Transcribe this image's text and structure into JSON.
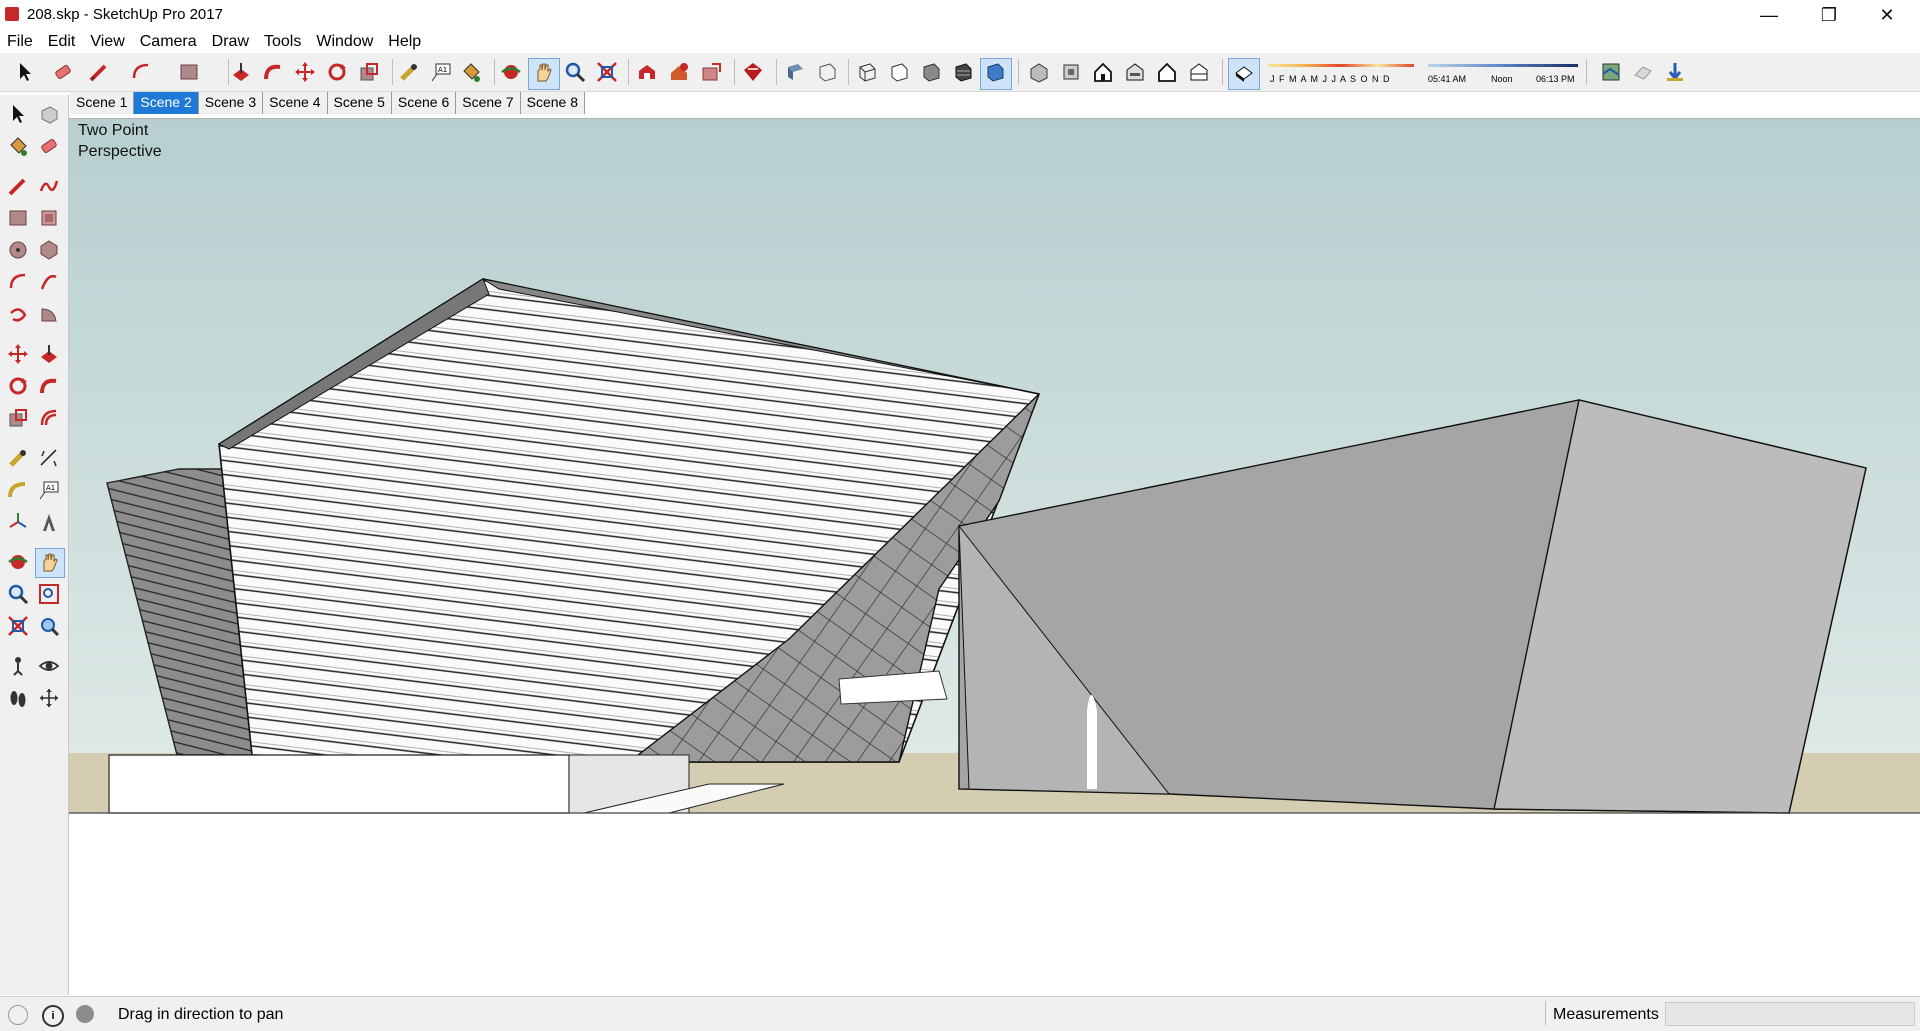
{
  "window": {
    "title": "208.skp - SketchUp Pro 2017",
    "minimize": "—",
    "restore": "❐",
    "close": "✕"
  },
  "menu": [
    "File",
    "Edit",
    "View",
    "Camera",
    "Draw",
    "Tools",
    "Window",
    "Help"
  ],
  "shadow_settings": {
    "months": "J F M A M J J A S O N D",
    "time_start": "05:41 AM",
    "time_mid": "Noon",
    "time_end": "06:13 PM"
  },
  "scenes": [
    "Scene 1",
    "Scene 2",
    "Scene 3",
    "Scene 4",
    "Scene 5",
    "Scene 6",
    "Scene 7",
    "Scene 8"
  ],
  "active_scene": "Scene 2",
  "viewport": {
    "camera_label_line1": "Two Point",
    "camera_label_line2": "Perspective"
  },
  "status": {
    "message": "Drag in direction to pan",
    "measurements_label": "Measurements",
    "measurements_value": ""
  },
  "colors": {
    "sky": "#bfd6d6",
    "ground": "#d6ceb3",
    "accent": "#1e7ad6",
    "brand": "#c62828"
  }
}
